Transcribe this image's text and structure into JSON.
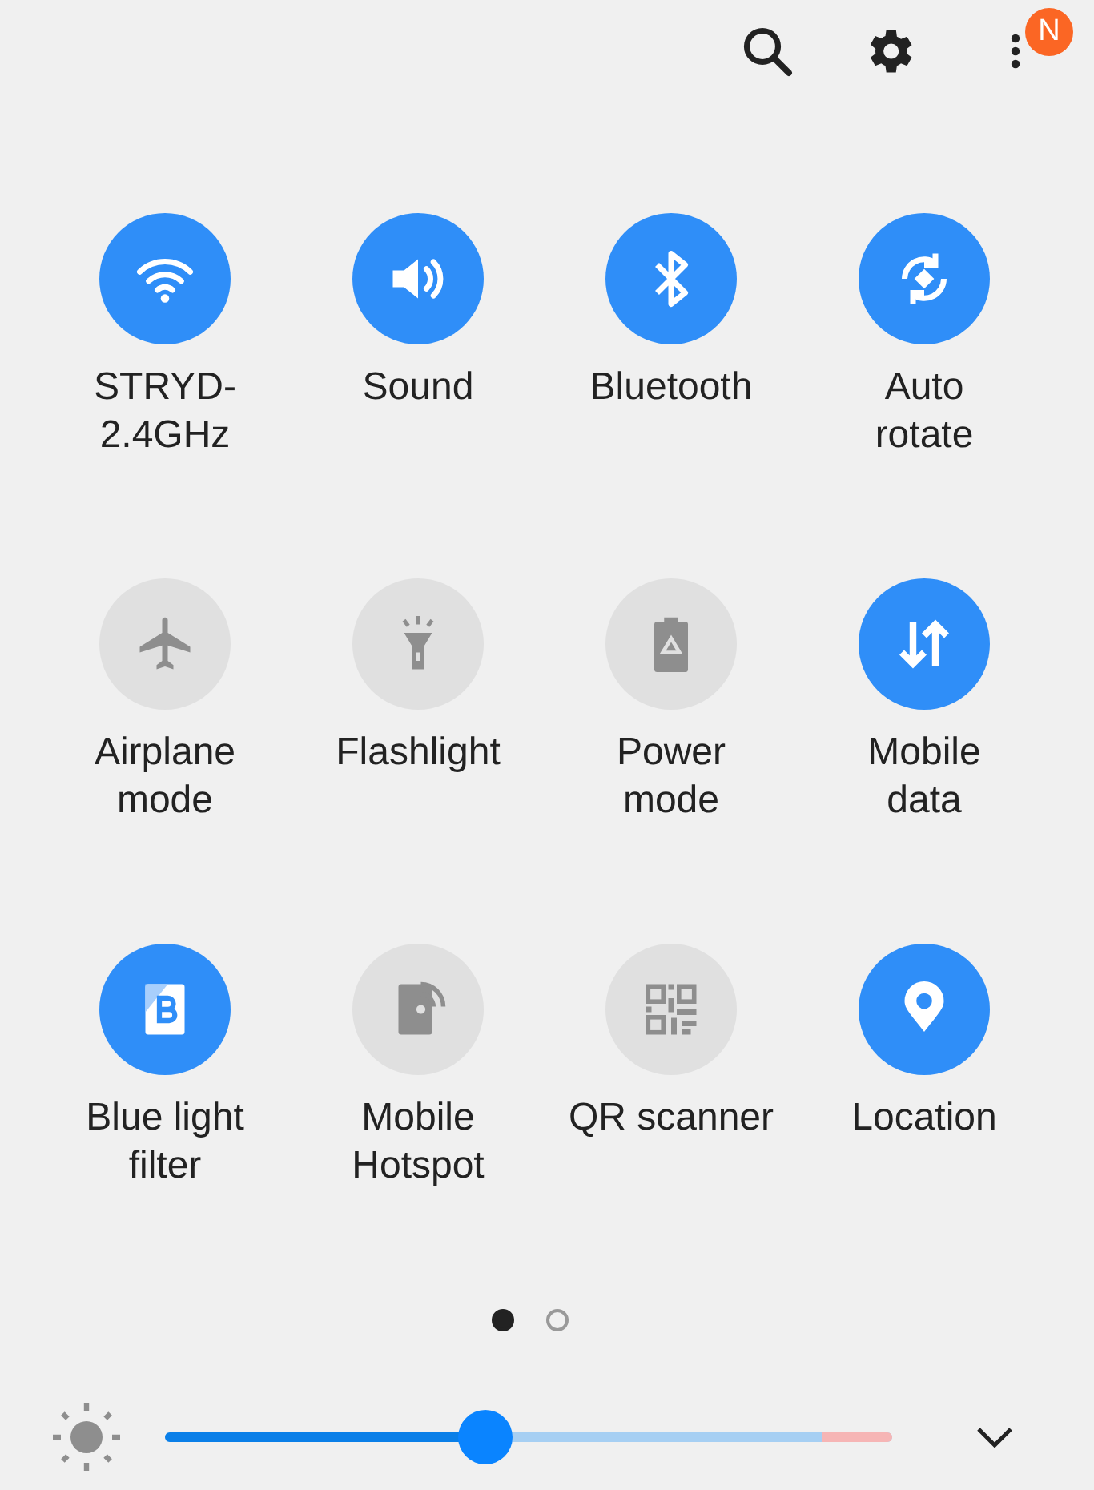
{
  "top_bar": {
    "badge": "N"
  },
  "tiles": [
    {
      "label": "STRYD-\n2.4GHz",
      "on": true
    },
    {
      "label": "Sound",
      "on": true
    },
    {
      "label": "Bluetooth",
      "on": true
    },
    {
      "label": "Auto\nrotate",
      "on": true
    },
    {
      "label": "Airplane\nmode",
      "on": false
    },
    {
      "label": "Flashlight",
      "on": false
    },
    {
      "label": "Power\nmode",
      "on": false
    },
    {
      "label": "Mobile\ndata",
      "on": true
    },
    {
      "label": "Blue light\nfilter",
      "on": true
    },
    {
      "label": "Mobile\nHotspot",
      "on": false
    },
    {
      "label": "QR scanner",
      "on": false
    },
    {
      "label": "Location",
      "on": true
    }
  ],
  "pages": [
    {
      "selected": true
    },
    {
      "selected": false
    }
  ],
  "brightness": {
    "level": 0.44
  }
}
